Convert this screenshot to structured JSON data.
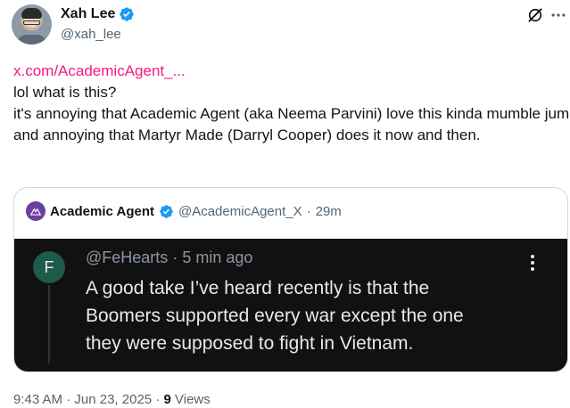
{
  "author": {
    "display_name": "Xah Lee",
    "handle": "@xah_lee",
    "avatar_icon": "person-photo",
    "verified_color": "#1d9bf0"
  },
  "actions": {
    "grok_icon": "grok-icon",
    "more_icon": "more-icon"
  },
  "tweet": {
    "link": "x.com/AcademicAgent_...",
    "lines": [
      "lol what is this?",
      "it's annoying that Academic Agent (aka Neema Parvini) love this kinda mumble jumble.",
      "and annoying that Martyr Made (Darryl Cooper) does it now and then."
    ],
    "link_color": "#f91880"
  },
  "quote": {
    "display_name": "Academic Agent",
    "handle": "@AcademicAgent_X",
    "separator": "·",
    "age": "29m",
    "media": {
      "avatar_letter": "F",
      "handle": "@FeHearts",
      "separator": "·",
      "age": "5 min ago",
      "lines": [
        "A good take I’ve heard recently is that the",
        "Boomers supported every war except the one",
        "they were supposed to fight in Vietnam."
      ]
    }
  },
  "footer": {
    "time": "9:43 AM",
    "separator": "·",
    "date": "Jun 23, 2025",
    "views_count": "9",
    "views_label": "Views"
  }
}
